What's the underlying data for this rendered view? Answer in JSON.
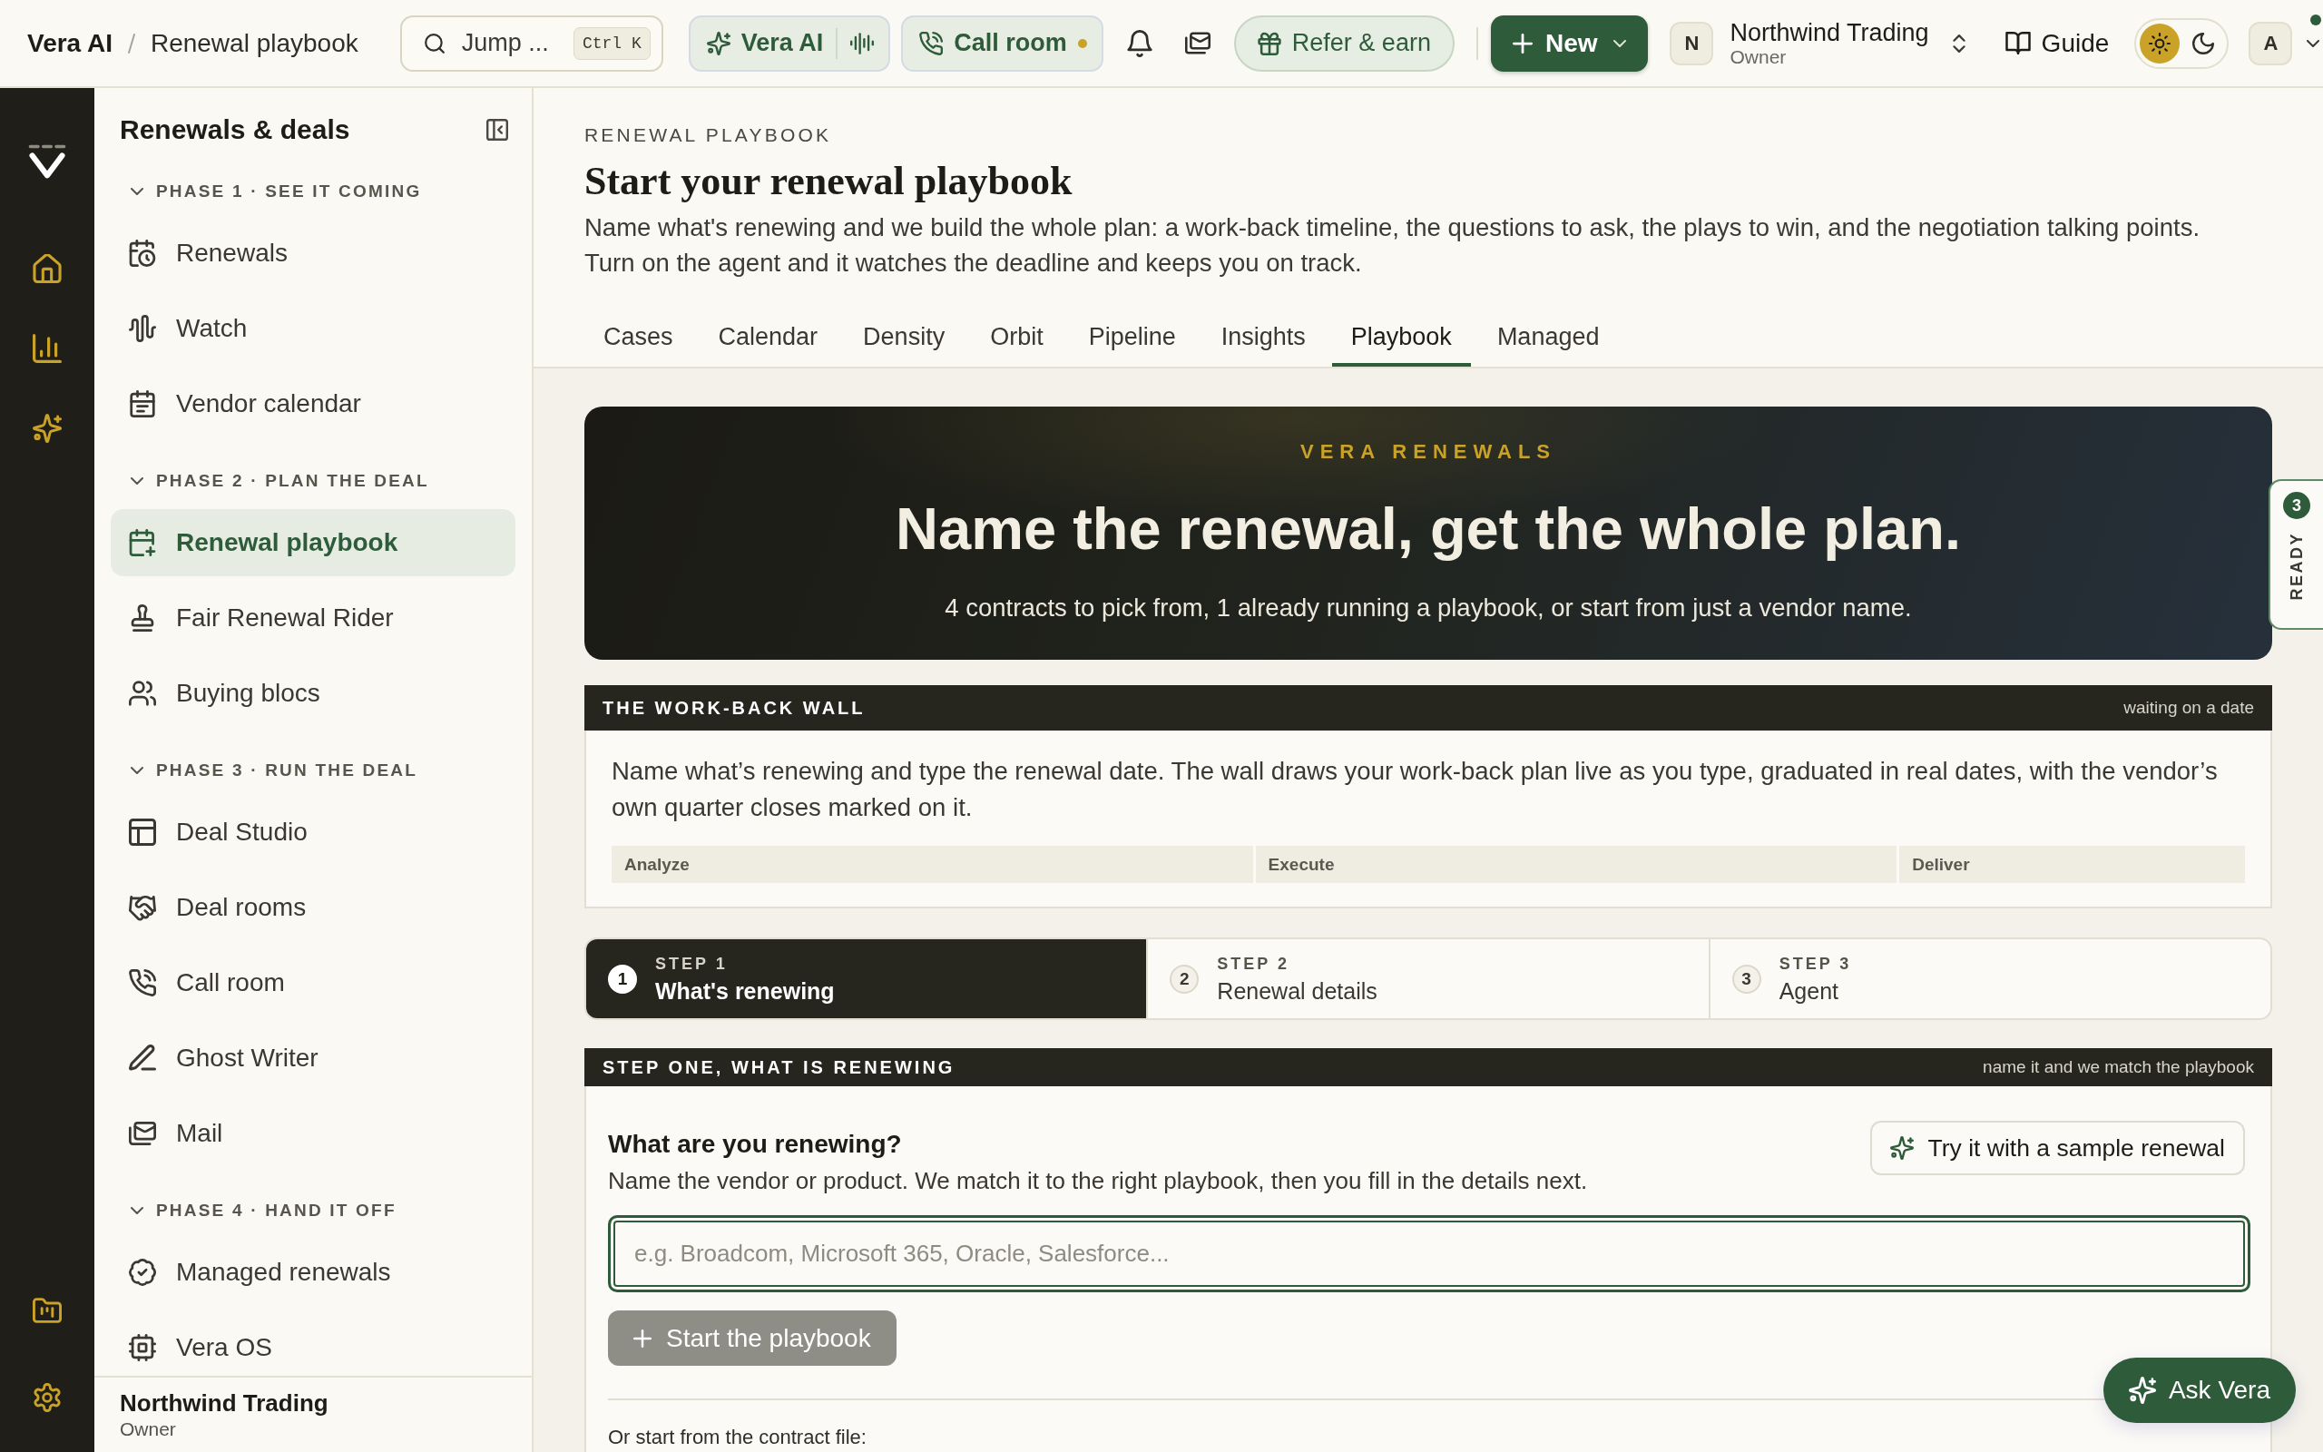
{
  "top_bar": {
    "breadcrumb": {
      "root": "Vera AI",
      "current": "Renewal playbook"
    },
    "search": {
      "placeholder": "Jump ...",
      "shortcut": "Ctrl K"
    },
    "vera_ai_button": {
      "label": "Vera AI"
    },
    "call_room_button": {
      "label": "Call room"
    },
    "refer_button": {
      "label": "Refer & earn"
    },
    "new_button": {
      "label": "New"
    },
    "workspace": {
      "initial": "N",
      "name": "Northwind Trading",
      "role": "Owner"
    },
    "guide_link": {
      "label": "Guide"
    },
    "theme_options": [
      {
        "kind": "light",
        "selected": true
      },
      {
        "kind": "dark",
        "selected": false
      }
    ],
    "account": {
      "initial": "A"
    }
  },
  "sidebar": {
    "title": "Renewals & deals",
    "sections": [
      {
        "label": "PHASE 1 · SEE IT COMING",
        "expanded": true,
        "items": [
          {
            "label": "Renewals",
            "selected": false
          },
          {
            "label": "Watch",
            "selected": false
          },
          {
            "label": "Vendor calendar",
            "selected": false
          }
        ]
      },
      {
        "label": "PHASE 2 · PLAN THE DEAL",
        "expanded": true,
        "items": [
          {
            "label": "Renewal playbook",
            "selected": true
          },
          {
            "label": "Fair Renewal Rider",
            "selected": false
          },
          {
            "label": "Buying blocs",
            "selected": false
          }
        ]
      },
      {
        "label": "PHASE 3 · RUN THE DEAL",
        "expanded": true,
        "items": [
          {
            "label": "Deal Studio",
            "selected": false
          },
          {
            "label": "Deal rooms",
            "selected": false
          },
          {
            "label": "Call room",
            "selected": false
          },
          {
            "label": "Ghost Writer",
            "selected": false
          },
          {
            "label": "Mail",
            "selected": false
          }
        ]
      },
      {
        "label": "PHASE 4 · HAND IT OFF",
        "expanded": true,
        "items": [
          {
            "label": "Managed renewals",
            "selected": false
          },
          {
            "label": "Vera OS",
            "selected": false
          }
        ]
      }
    ],
    "footer": {
      "name": "Northwind Trading",
      "role": "Owner"
    }
  },
  "header": {
    "eyebrow": "RENEWAL PLAYBOOK",
    "title": "Start your renewal playbook",
    "description": "Name what's renewing and we build the whole plan: a work-back timeline, the questions to ask, the plays to win, and the negotiation talking points. Turn on the agent and it watches the deadline and keeps you on track."
  },
  "tabs": [
    {
      "label": "Cases",
      "selected": false
    },
    {
      "label": "Calendar",
      "selected": false
    },
    {
      "label": "Density",
      "selected": false
    },
    {
      "label": "Orbit",
      "selected": false
    },
    {
      "label": "Pipeline",
      "selected": false
    },
    {
      "label": "Insights",
      "selected": false
    },
    {
      "label": "Playbook",
      "selected": true
    },
    {
      "label": "Managed",
      "selected": false
    }
  ],
  "hero": {
    "eyebrow": "VERA RENEWALS",
    "headline": "Name the renewal, get the whole plan.",
    "summary": "4 contracts to pick from, 1 already running a playbook, or start from just a vendor name."
  },
  "ready_tab": {
    "count": "3",
    "label": "READY"
  },
  "work_back_wall": {
    "title": "THE WORK-BACK WALL",
    "status": "waiting on a date",
    "description": "Name what’s renewing and type the renewal date. The wall draws your work-back plan live as you type, graduated in real dates, with the vendor’s own quarter closes marked on it.",
    "phases": [
      {
        "label": "Analyze"
      },
      {
        "label": "Execute"
      },
      {
        "label": "Deliver"
      }
    ]
  },
  "steps": [
    {
      "number": "1",
      "label": "STEP 1",
      "title": "What's renewing",
      "selected": true
    },
    {
      "number": "2",
      "label": "STEP 2",
      "title": "Renewal details",
      "selected": false
    },
    {
      "number": "3",
      "label": "STEP 3",
      "title": "Agent",
      "selected": false
    }
  ],
  "step_one": {
    "title": "STEP ONE, WHAT IS RENEWING",
    "hint": "name it and we match the playbook",
    "question": "What are you renewing?",
    "description": "Name the vendor or product. We match it to the right playbook, then you fill in the details next.",
    "sample_button": {
      "label": "Try it with a sample renewal"
    },
    "vendor_field": {
      "placeholder": "e.g. Broadcom, Microsoft 365, Oracle, Salesforce...",
      "focused": true
    },
    "start_button": {
      "label": "Start the playbook",
      "disabled": true
    },
    "contract_prompt": "Or start from the contract file:"
  },
  "ask_vera_button": {
    "label": "Ask Vera"
  }
}
